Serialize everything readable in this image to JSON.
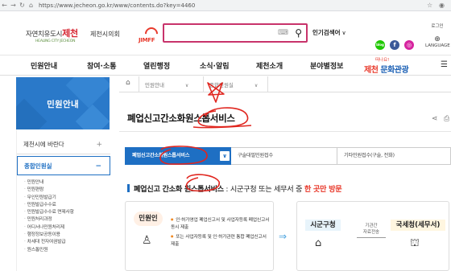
{
  "browser": {
    "url": "https://www.jecheon.go.kr/www/contents.do?key=4460",
    "icons": [
      "back-icon",
      "forward-icon",
      "reload-icon",
      "home-icon"
    ]
  },
  "header": {
    "logo": {
      "city_prefix": "자연치유도시",
      "city_name": "제천",
      "slogan": "HEALING CITY JECHEON"
    },
    "council": "제천시의회",
    "festival_logo": "JIMFF",
    "search": {
      "placeholder": "",
      "keyboard_icon": "keyboard-icon",
      "search_icon": "search-icon"
    },
    "popular_label": "인기검색어",
    "popular_chevron": "∨",
    "sns": [
      {
        "name": "blog",
        "label": "blog",
        "color": "#1ec800"
      },
      {
        "name": "facebook",
        "label": "f",
        "color": "#3b5998"
      },
      {
        "name": "instagram",
        "label": "◎",
        "color": "#d6249f"
      }
    ],
    "login_label": "로그인",
    "language_label": "LANGUAGE"
  },
  "gnb": {
    "items": [
      "민원안내",
      "참여·소통",
      "열린행정",
      "소식·알림",
      "제천소개",
      "분야별정보"
    ],
    "tourism_top": "떠나요!",
    "tourism_prefix": "제천",
    "tourism_main": "문화관광",
    "menu_icon": "☰"
  },
  "sidebar": {
    "title": "민원안내",
    "items": [
      {
        "label": "제천시에 바란다",
        "pm": "+"
      },
      {
        "label": "종합민원실",
        "pm": "−"
      }
    ],
    "sub_items": [
      "민원안내",
      "민원편람",
      "무인민원발급기",
      "민원발급수수료",
      "민원발급수수료 면제사항",
      "민원처리과정",
      "어디서나민원처리제",
      "행정정보공동이용",
      "차세대 전자여권발급",
      "원스톱민원"
    ]
  },
  "breadcrumb": {
    "home_icon": "⌂",
    "level1": "민원안내",
    "level2": "종합민원실",
    "arrow": "∨"
  },
  "page": {
    "title": "폐업신고간소화원스톱서비스",
    "share_icon": "⋖",
    "print_icon": "⎙"
  },
  "tabs": [
    {
      "label": "폐업신고간소화원스톱서비스",
      "active": true
    },
    {
      "label": "구술대필민원접수",
      "active": false
    },
    {
      "label": "기타민원접수(구술, 전화)",
      "active": false
    }
  ],
  "section": {
    "prefix": "폐업신고 간소화 원스톱서비스",
    "middle": " : 시군구청 또는 세무서 중 ",
    "highlight": "한 곳만 방문"
  },
  "flow": {
    "person_label": "민원인",
    "desc": [
      "인·허가영업 폐업신고서 및 사업자등록 폐업신고서 동시 제출",
      "또는 사업자등록 및 인·허가관련 통합 폐업신고서 제출"
    ],
    "arrows": "⇒",
    "gov_label": "시군구청",
    "mid_line1": "기관간",
    "mid_line2": "자료전송",
    "tax_label": "국세청(세무서)"
  },
  "colors": {
    "primary": "#1e6fc3",
    "sidebar_banner": "#2a79c9",
    "search_border": "#c8336b",
    "annotation_red": "#e0261f",
    "highlight_red": "#e8392b"
  }
}
